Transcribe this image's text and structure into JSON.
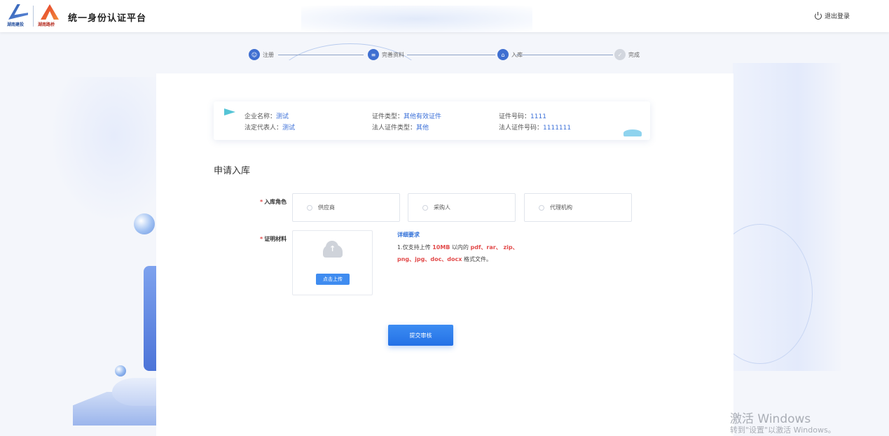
{
  "header": {
    "logo1_text": "湖南建投",
    "logo2_text": "湖南路桥",
    "title": "统一身份认证平台",
    "logout_label": "退出登录"
  },
  "steps": [
    {
      "label": "注册",
      "icon": "user-icon"
    },
    {
      "label": "完善资料",
      "icon": "document-icon"
    },
    {
      "label": "入库",
      "icon": "home-icon"
    },
    {
      "label": "完成",
      "icon": "check-icon"
    }
  ],
  "info": {
    "company_label": "企业名称：",
    "company_value": "测试",
    "legal_rep_label": "法定代表人：",
    "legal_rep_value": "测试",
    "cert_type_label": "证件类型：",
    "cert_type_value": "其他有效证件",
    "legal_cert_type_label": "法人证件类型：",
    "legal_cert_type_value": "其他",
    "cert_no_label": "证件号码：",
    "cert_no_value": "1111",
    "legal_cert_no_label": "法人证件号码：",
    "legal_cert_no_value": "1111111"
  },
  "form": {
    "section_title": "申请入库",
    "role_label": "入库角色",
    "role_options": [
      "供应商",
      "采购人",
      "代理机构"
    ],
    "material_label": "证明材料",
    "upload_button": "点击上传",
    "req_title": "详细要求",
    "req_line1_prefix": "1.仅支持上传",
    "req_line1_size": "10MB",
    "req_line1_mid": "以内的",
    "req_line1_formats": "pdf、rar、 zip、",
    "req_line2_formats": "png、jpg、doc、docx",
    "req_line2_suffix": "格式文件。",
    "submit_label": "提交审核",
    "required_mark": "*"
  },
  "watermark": {
    "line1": "激活 Windows",
    "line2": "转到\"设置\"以激活 Windows。"
  },
  "colors": {
    "accent": "#3f6fd1",
    "primary_button": "#2f7ef0",
    "required": "#e24a4a",
    "value_text": "#3a6fd8"
  }
}
